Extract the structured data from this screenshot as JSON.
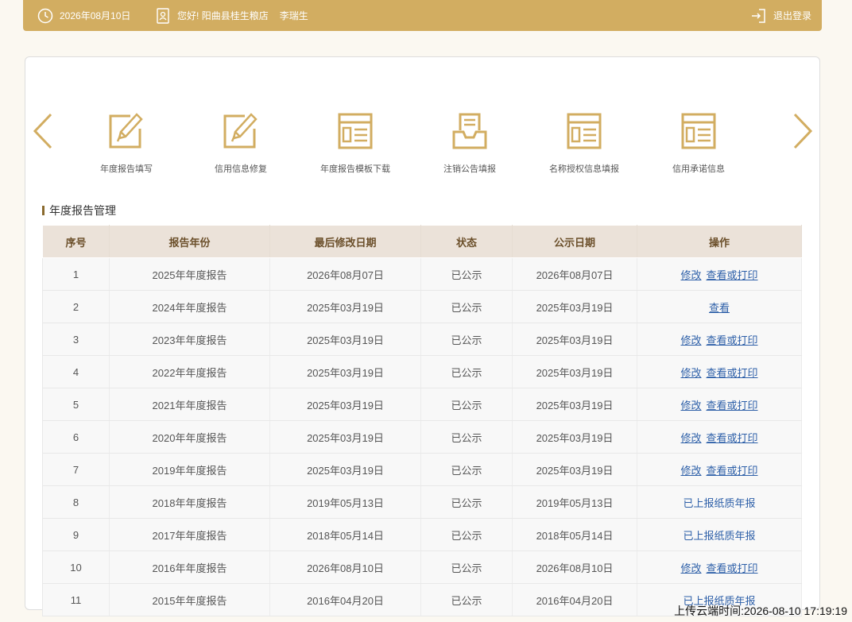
{
  "topbar": {
    "date": "2026年08月10日",
    "greeting": "您好!",
    "company": "阳曲县桂生粮店",
    "user": "李瑞生",
    "logout": "退出登录"
  },
  "nav": {
    "items": [
      {
        "label": "年度报告填写",
        "icon": "edit-document-icon"
      },
      {
        "label": "信用信息修复",
        "icon": "edit-document-icon"
      },
      {
        "label": "年度报告模板下载",
        "icon": "template-icon"
      },
      {
        "label": "注销公告填报",
        "icon": "inbox-tray-icon"
      },
      {
        "label": "名称授权信息填报",
        "icon": "template-icon"
      },
      {
        "label": "信用承诺信息",
        "icon": "template-icon"
      }
    ]
  },
  "section": {
    "title": "年度报告管理"
  },
  "table": {
    "headers": [
      "序号",
      "报告年份",
      "最后修改日期",
      "状态",
      "公示日期",
      "操作"
    ],
    "rows": [
      {
        "no": "1",
        "year": "2025年年度报告",
        "modified": "2026年08月07日",
        "status": "已公示",
        "published": "2026年08月07日",
        "actions": [
          "修改",
          "查看或打印"
        ]
      },
      {
        "no": "2",
        "year": "2024年年度报告",
        "modified": "2025年03月19日",
        "status": "已公示",
        "published": "2025年03月19日",
        "actions": [
          "查看"
        ]
      },
      {
        "no": "3",
        "year": "2023年年度报告",
        "modified": "2025年03月19日",
        "status": "已公示",
        "published": "2025年03月19日",
        "actions": [
          "修改",
          "查看或打印"
        ]
      },
      {
        "no": "4",
        "year": "2022年年度报告",
        "modified": "2025年03月19日",
        "status": "已公示",
        "published": "2025年03月19日",
        "actions": [
          "修改",
          "查看或打印"
        ]
      },
      {
        "no": "5",
        "year": "2021年年度报告",
        "modified": "2025年03月19日",
        "status": "已公示",
        "published": "2025年03月19日",
        "actions": [
          "修改",
          "查看或打印"
        ]
      },
      {
        "no": "6",
        "year": "2020年年度报告",
        "modified": "2025年03月19日",
        "status": "已公示",
        "published": "2025年03月19日",
        "actions": [
          "修改",
          "查看或打印"
        ]
      },
      {
        "no": "7",
        "year": "2019年年度报告",
        "modified": "2025年03月19日",
        "status": "已公示",
        "published": "2025年03月19日",
        "actions": [
          "修改",
          "查看或打印"
        ]
      },
      {
        "no": "8",
        "year": "2018年年度报告",
        "modified": "2019年05月13日",
        "status": "已公示",
        "published": "2019年05月13日",
        "actions": [
          "已上报纸质年报"
        ]
      },
      {
        "no": "9",
        "year": "2017年年度报告",
        "modified": "2018年05月14日",
        "status": "已公示",
        "published": "2018年05月14日",
        "actions": [
          "已上报纸质年报"
        ]
      },
      {
        "no": "10",
        "year": "2016年年度报告",
        "modified": "2026年08月10日",
        "status": "已公示",
        "published": "2026年08月10日",
        "actions": [
          "修改",
          "查看或打印"
        ]
      },
      {
        "no": "11",
        "year": "2015年年度报告",
        "modified": "2016年04月20日",
        "status": "已公示",
        "published": "2016年04月20日",
        "actions": [
          "已上报纸质年报"
        ]
      }
    ]
  },
  "footer": {
    "upload_time": "上传云端时间:2026-08-10 17:19:19"
  },
  "colors": {
    "brand": "#d2ad61",
    "header_bg": "#ebe2d9",
    "link": "#2d5fa8"
  }
}
